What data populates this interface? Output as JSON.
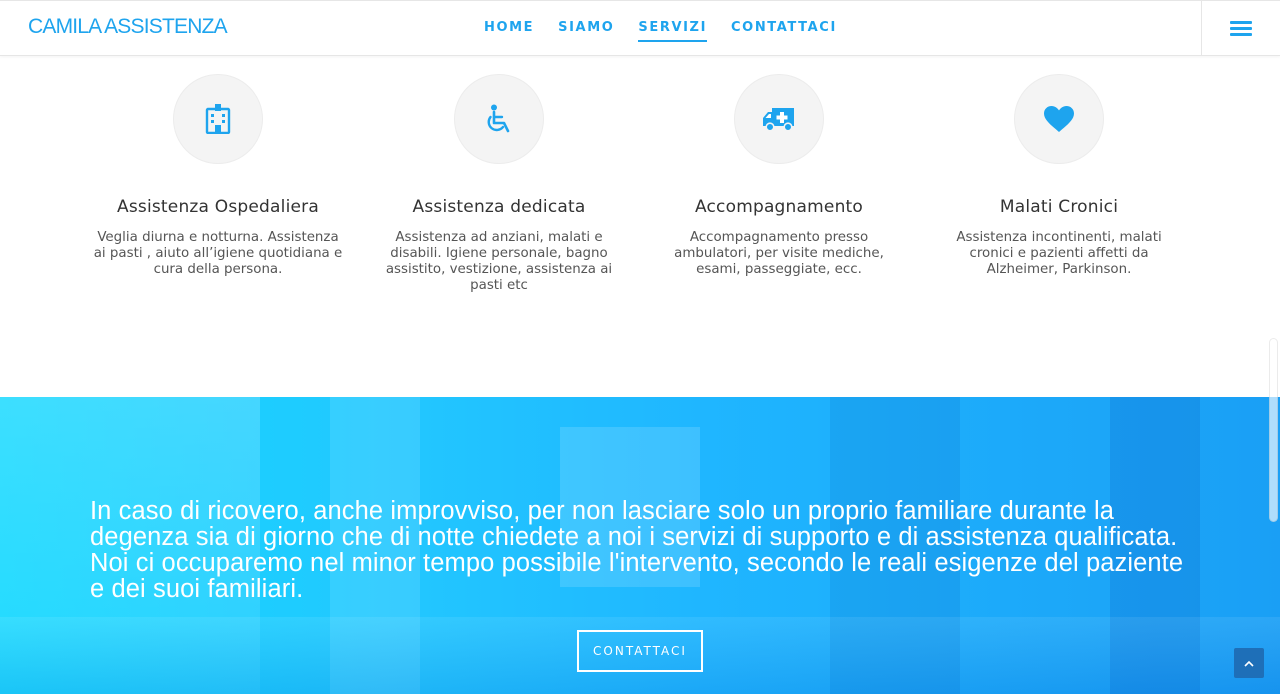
{
  "header": {
    "logo": "CAMILA ASSISTENZA",
    "nav": [
      {
        "label": "HOME"
      },
      {
        "label": "SIAMO"
      },
      {
        "label": "SERVIZI",
        "active": true
      },
      {
        "label": "CONTATTACI"
      }
    ],
    "menu_icon": "hamburger-menu-icon"
  },
  "services": [
    {
      "icon": "hospital-icon",
      "title": "Assistenza Ospedaliera",
      "description": "Veglia diurna e notturna. Assistenza ai pasti , aiuto all’igiene quotidiana e cura della persona."
    },
    {
      "icon": "wheelchair-icon",
      "title": "Assistenza dedicata",
      "description": "Assistenza ad anziani, malati e disabili. Igiene personale, bagno assistito, vestizione, assistenza ai pasti etc"
    },
    {
      "icon": "ambulance-icon",
      "title": "Accompagnamento",
      "description": "Accompagnamento presso ambulatori, per visite mediche, esami, passeggiate, ecc."
    },
    {
      "icon": "heart-icon",
      "title": "Malati Cronici",
      "description": "Assistenza incontinenti, malati cronici e pazienti affetti da Alzheimer, Parkinson."
    }
  ],
  "hero": {
    "text": "In caso di ricovero, anche improvviso, per non lasciare solo un proprio familiare durante la degenza sia di giorno che di notte chiedete a noi i servizi di supporto e di assistenza qualificata. Noi ci occuparemo nel minor tempo possibile l'intervento, secondo le reali esigenze del paziente e dei suoi familiari.",
    "button_label": "CONTATTACI"
  },
  "back_to_top_icon": "chevron-up-icon",
  "colors": {
    "accent": "#1ea4ee",
    "hero": "#12d8ff",
    "back_to_top": "#1e6fb8"
  }
}
